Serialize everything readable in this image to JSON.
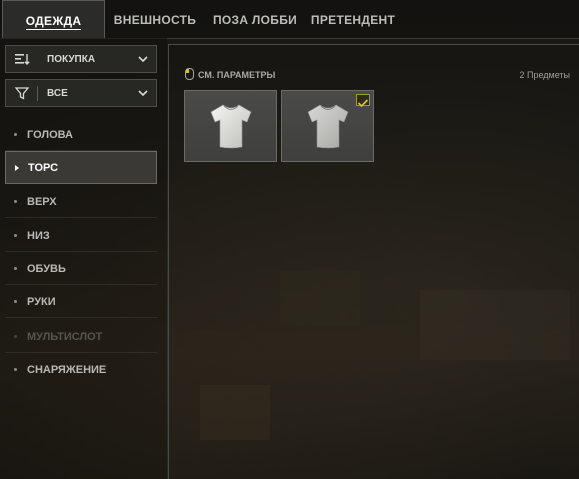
{
  "tabs": [
    {
      "label": "ОДЕЖДА",
      "active": true
    },
    {
      "label": "ВНЕШНОСТЬ",
      "active": false
    },
    {
      "label": "ПОЗА ЛОББИ",
      "active": false
    },
    {
      "label": "ПРЕТЕНДЕНТ",
      "active": false
    }
  ],
  "sidebar": {
    "sort_dropdown": {
      "label": "ПОКУПКА",
      "icon": "sort-icon"
    },
    "filter_dropdown": {
      "label": "ВСЕ",
      "icon": "filter-icon"
    },
    "categories": [
      {
        "label": "ГОЛОВА",
        "state": "normal"
      },
      {
        "label": "ТОРС",
        "state": "active"
      },
      {
        "label": "ВЕРХ",
        "state": "normal"
      },
      {
        "label": "НИЗ",
        "state": "normal"
      },
      {
        "label": "ОБУВЬ",
        "state": "normal"
      },
      {
        "label": "РУКИ",
        "state": "normal"
      },
      {
        "label": "МУЛЬТИСЛОТ",
        "state": "disabled"
      },
      {
        "label": "СНАРЯЖЕНИЕ",
        "state": "normal"
      }
    ]
  },
  "main": {
    "params_label": "СМ. ПАРАМЕТРЫ",
    "params_icon": "mouse-icon",
    "item_count": "2 Предметы",
    "items": [
      {
        "icon": "tshirt-icon",
        "equipped": false
      },
      {
        "icon": "tshirt-icon",
        "equipped": true
      }
    ]
  },
  "colors": {
    "accent_check": "#d4c235",
    "active_tab_bg": "#2b2b29"
  }
}
